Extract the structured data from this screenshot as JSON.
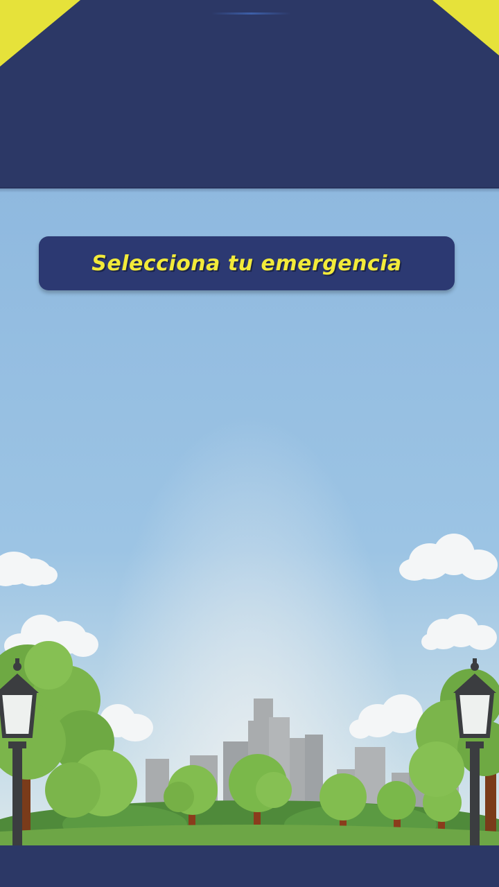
{
  "header": {
    "accent_color": "#e6e23a",
    "background_color": "#2c3866"
  },
  "main": {
    "title": "Selecciona tu emergencia",
    "title_color": "#f2ea3a",
    "banner_color": "#2c3972"
  },
  "scene": {
    "background": "park-skyline-illustration",
    "elements": [
      "clouds",
      "city-skyline",
      "trees",
      "street-lamps",
      "grass"
    ]
  },
  "footer": {
    "background_color": "#2c3866"
  }
}
